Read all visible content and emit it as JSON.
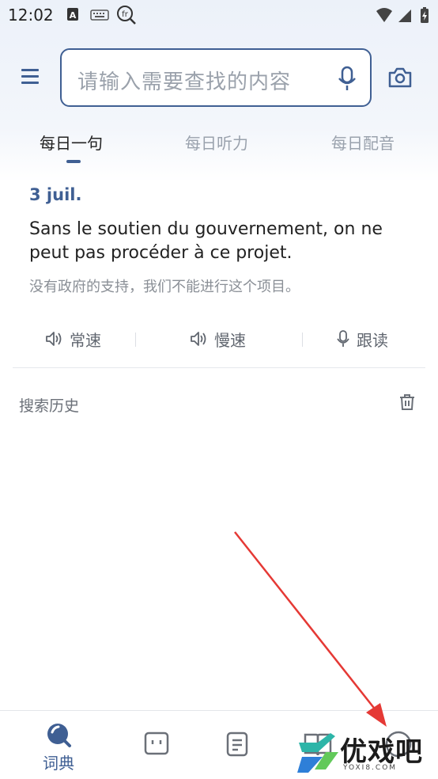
{
  "status_bar": {
    "time": "12:02",
    "icons": [
      "a-box-icon",
      "keyboard-icon",
      "fr-search-icon",
      "wifi-icon",
      "signal-icon",
      "battery-charging-icon"
    ]
  },
  "search": {
    "placeholder": "请输入需要查找的内容"
  },
  "tabs": [
    {
      "label": "每日一句",
      "active": true
    },
    {
      "label": "每日听力",
      "active": false
    },
    {
      "label": "每日配音",
      "active": false
    }
  ],
  "daily": {
    "date": "3 juil.",
    "sentence": "Sans le soutien du gouvernement, on ne peut pas procéder à ce projet.",
    "translation": "没有政府的支持，我们不能进行这个项目。",
    "actions": [
      {
        "label": "常速",
        "icon": "speaker-icon"
      },
      {
        "label": "慢速",
        "icon": "speaker-icon"
      },
      {
        "label": "跟读",
        "icon": "mic-icon"
      }
    ]
  },
  "history": {
    "title": "搜索历史"
  },
  "bottom_nav": {
    "items": [
      {
        "label": "词典",
        "icon": "dictionary-search-icon",
        "active": true
      },
      {
        "label": "",
        "icon": "chat-face-icon"
      },
      {
        "label": "",
        "icon": "notes-icon"
      },
      {
        "label": "",
        "icon": "book-icon"
      },
      {
        "label": "",
        "icon": "profile-circle-icon"
      }
    ]
  },
  "watermark": {
    "text": "优戏吧",
    "sub": "YOXI8.COM"
  },
  "colors": {
    "accent": "#3f5f93",
    "annotation_arrow": "#e53935"
  }
}
